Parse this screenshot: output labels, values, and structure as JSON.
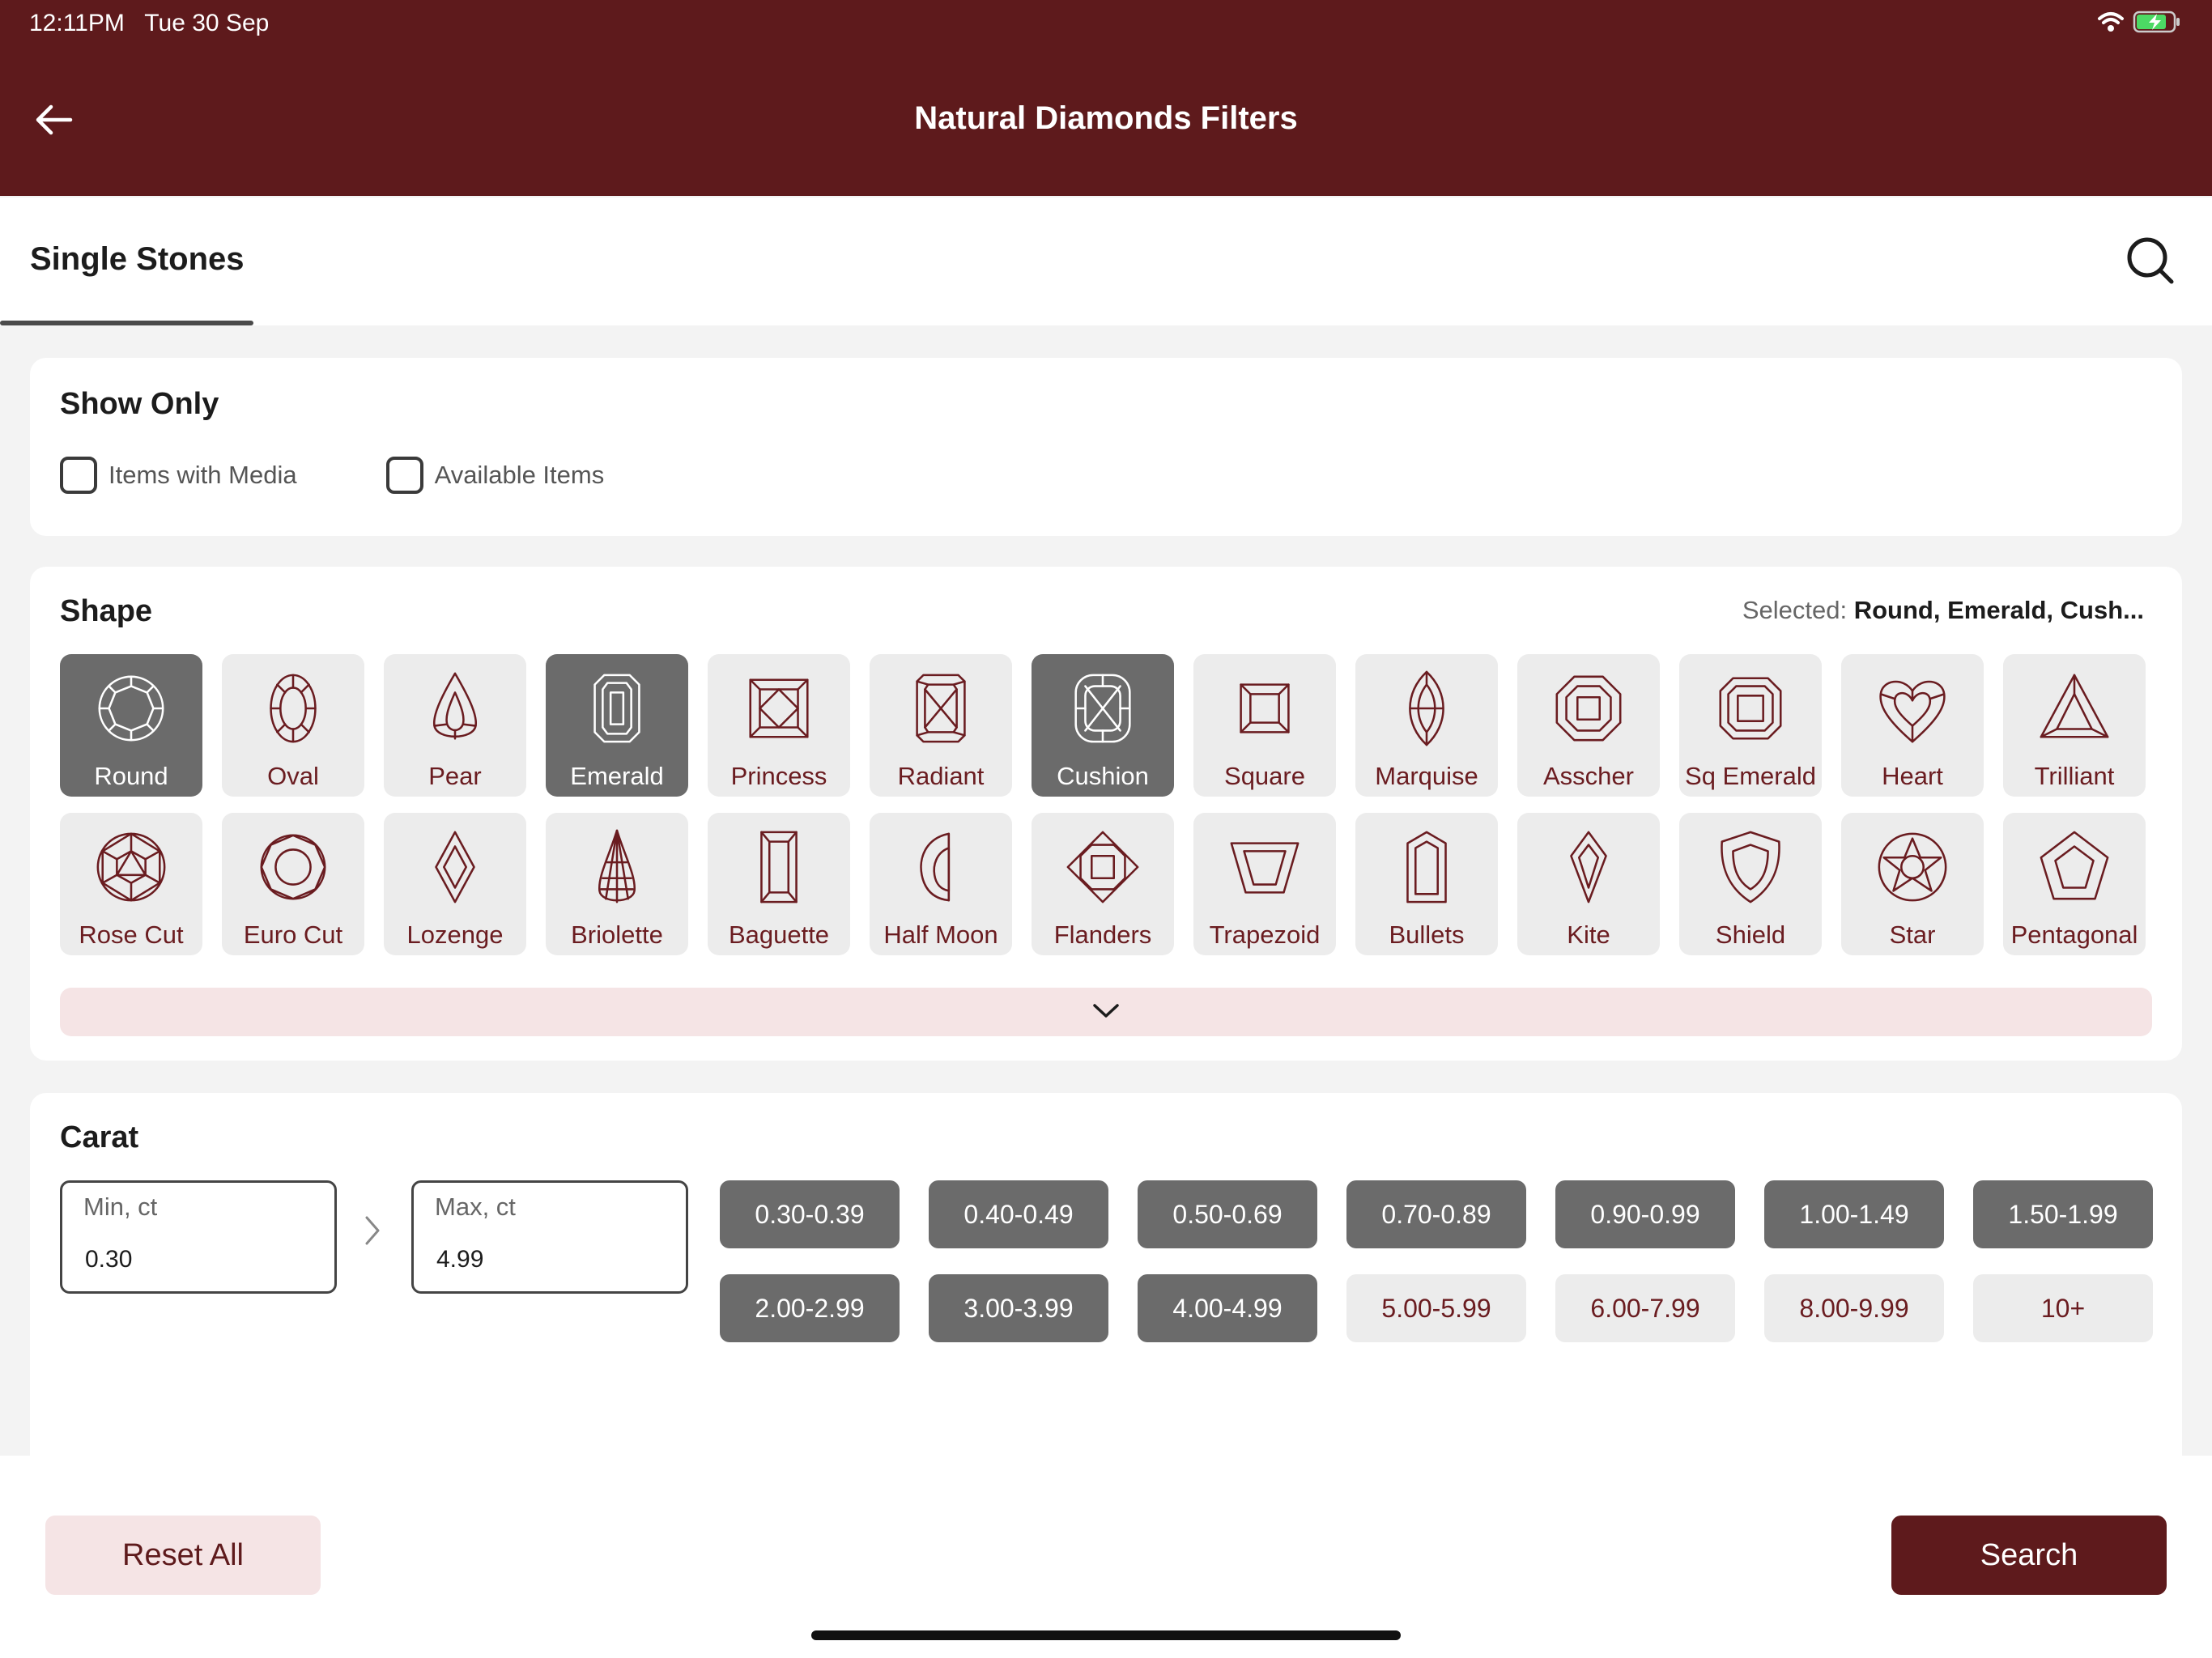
{
  "status_bar": {
    "time": "12:11PM   Tue 30 Sep"
  },
  "header": {
    "title": "Natural Diamonds Filters"
  },
  "tabs": [
    {
      "label": "Single Stones",
      "active": true
    }
  ],
  "show_only": {
    "title": "Show Only",
    "options": [
      {
        "label": "Items with Media",
        "checked": false
      },
      {
        "label": "Available Items",
        "checked": false
      }
    ]
  },
  "shape": {
    "title": "Shape",
    "selected_prefix": "Selected:",
    "selected_value": "Round, Emerald, Cush...",
    "items": [
      {
        "label": "Round",
        "icon": "round-shape-icon",
        "selected": true
      },
      {
        "label": "Oval",
        "icon": "oval-shape-icon",
        "selected": false
      },
      {
        "label": "Pear",
        "icon": "pear-shape-icon",
        "selected": false
      },
      {
        "label": "Emerald",
        "icon": "emerald-shape-icon",
        "selected": true
      },
      {
        "label": "Princess",
        "icon": "princess-shape-icon",
        "selected": false
      },
      {
        "label": "Radiant",
        "icon": "radiant-shape-icon",
        "selected": false
      },
      {
        "label": "Cushion",
        "icon": "cushion-shape-icon",
        "selected": true
      },
      {
        "label": "Square",
        "icon": "square-shape-icon",
        "selected": false
      },
      {
        "label": "Marquise",
        "icon": "marquise-shape-icon",
        "selected": false
      },
      {
        "label": "Asscher",
        "icon": "asscher-shape-icon",
        "selected": false
      },
      {
        "label": "Sq Emerald",
        "icon": "sq-emerald-shape-icon",
        "selected": false
      },
      {
        "label": "Heart",
        "icon": "heart-shape-icon",
        "selected": false
      },
      {
        "label": "Trilliant",
        "icon": "trilliant-shape-icon",
        "selected": false
      },
      {
        "label": "Rose Cut",
        "icon": "rose-cut-shape-icon",
        "selected": false
      },
      {
        "label": "Euro Cut",
        "icon": "euro-cut-shape-icon",
        "selected": false
      },
      {
        "label": "Lozenge",
        "icon": "lozenge-shape-icon",
        "selected": false
      },
      {
        "label": "Briolette",
        "icon": "briolette-shape-icon",
        "selected": false
      },
      {
        "label": "Baguette",
        "icon": "baguette-shape-icon",
        "selected": false
      },
      {
        "label": "Half Moon",
        "icon": "half-moon-shape-icon",
        "selected": false
      },
      {
        "label": "Flanders",
        "icon": "flanders-shape-icon",
        "selected": false
      },
      {
        "label": "Trapezoid",
        "icon": "trapezoid-shape-icon",
        "selected": false
      },
      {
        "label": "Bullets",
        "icon": "bullets-shape-icon",
        "selected": false
      },
      {
        "label": "Kite",
        "icon": "kite-shape-icon",
        "selected": false
      },
      {
        "label": "Shield",
        "icon": "shield-shape-icon",
        "selected": false
      },
      {
        "label": "Star",
        "icon": "star-shape-icon",
        "selected": false
      },
      {
        "label": "Pentagonal",
        "icon": "pentagonal-shape-icon",
        "selected": false
      }
    ]
  },
  "carat": {
    "title": "Carat",
    "min": {
      "placeholder": "Min, ct",
      "value": "0.30"
    },
    "max": {
      "placeholder": "Max, ct",
      "value": "4.99"
    },
    "ranges": [
      {
        "label": "0.30-0.39",
        "selected": true
      },
      {
        "label": "0.40-0.49",
        "selected": true
      },
      {
        "label": "0.50-0.69",
        "selected": true
      },
      {
        "label": "0.70-0.89",
        "selected": true
      },
      {
        "label": "0.90-0.99",
        "selected": true
      },
      {
        "label": "1.00-1.49",
        "selected": true
      },
      {
        "label": "1.50-1.99",
        "selected": true
      },
      {
        "label": "2.00-2.99",
        "selected": true
      },
      {
        "label": "3.00-3.99",
        "selected": true
      },
      {
        "label": "4.00-4.99",
        "selected": true
      },
      {
        "label": "5.00-5.99",
        "selected": false
      },
      {
        "label": "6.00-7.99",
        "selected": false
      },
      {
        "label": "8.00-9.99",
        "selected": false
      },
      {
        "label": "10+",
        "selected": false
      }
    ]
  },
  "footer": {
    "reset_label": "Reset All",
    "search_label": "Search"
  },
  "colors": {
    "brand": "#5e1a1c",
    "selected_tile": "#6b6b6b",
    "tile": "#ececec",
    "accent_light": "#f5e4e5"
  }
}
